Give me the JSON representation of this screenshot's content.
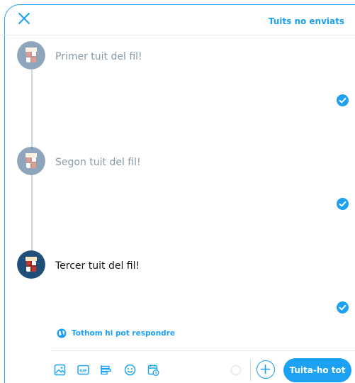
{
  "header": {
    "close_icon": "close-icon",
    "drafts_label": "Tuits no enviats"
  },
  "thread": {
    "tweets": [
      {
        "placeholder": "Primer tuit del fil!",
        "state": "inactive"
      },
      {
        "placeholder": "Segon tuit del fil!",
        "state": "inactive"
      },
      {
        "placeholder": "Tercer tuit del fil!",
        "state": "active"
      }
    ]
  },
  "reply_setting": {
    "label": "Tothom hi pot respondre",
    "icon": "globe-icon"
  },
  "toolbar": {
    "icons": [
      "image-icon",
      "gif-icon",
      "poll-icon",
      "emoji-icon",
      "schedule-icon"
    ],
    "tweet_all_label": "Tuita-ho tot",
    "add_icon": "plus-icon"
  },
  "colors": {
    "accent": "#1da1f2",
    "border": "#e6ecf0",
    "placeholder": "#8899a6",
    "avatar_bg": "#1f4e79"
  }
}
